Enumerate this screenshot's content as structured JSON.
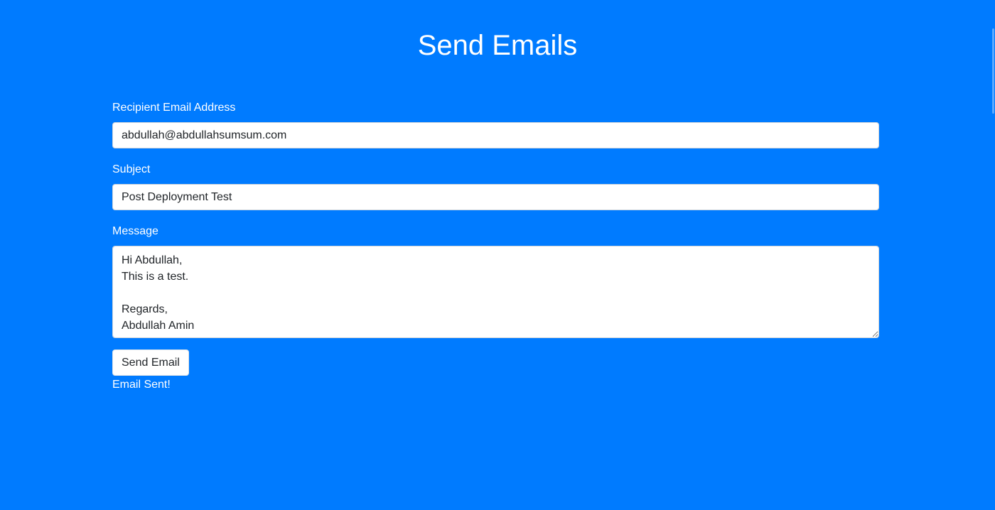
{
  "page": {
    "title": "Send Emails",
    "background_color": "#007bff"
  },
  "form": {
    "recipient": {
      "label": "Recipient Email Address",
      "value": "abdullah@abdullahsumsum.com"
    },
    "subject": {
      "label": "Subject",
      "value": "Post Deployment Test"
    },
    "message": {
      "label": "Message",
      "value": "Hi Abdullah,\nThis is a test.\n\nRegards,\nAbdullah Amin"
    },
    "submit_label": "Send Email",
    "status": "Email Sent!"
  }
}
